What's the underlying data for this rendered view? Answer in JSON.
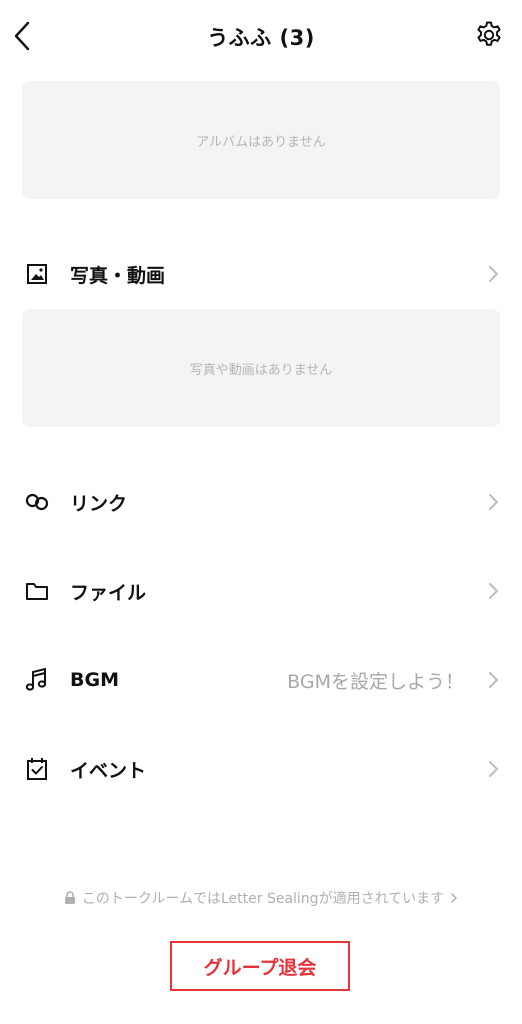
{
  "header": {
    "title": "うふふ (3)",
    "back_icon": "chevron-left-icon",
    "settings_icon": "gear-icon"
  },
  "album": {
    "empty_text": "アルバムはありません"
  },
  "photos": {
    "label": "写真・動画",
    "icon": "photo-icon",
    "empty_text": "写真や動画はありません"
  },
  "links": {
    "label": "リンク",
    "icon": "link-icon"
  },
  "files": {
    "label": "ファイル",
    "icon": "folder-icon"
  },
  "bgm": {
    "label": "BGM",
    "icon": "music-note-icon",
    "value": "BGMを設定しよう！"
  },
  "events": {
    "label": "イベント",
    "icon": "calendar-check-icon"
  },
  "notice": {
    "text": "このトークルームではLetter Sealingが適用されています",
    "icon": "lock-icon"
  },
  "leave_button": {
    "label": "グループ退会"
  },
  "colors": {
    "accent_red": "#e8333b",
    "placeholder_bg": "#f4f4f4",
    "muted_text": "#a8a8a8"
  }
}
